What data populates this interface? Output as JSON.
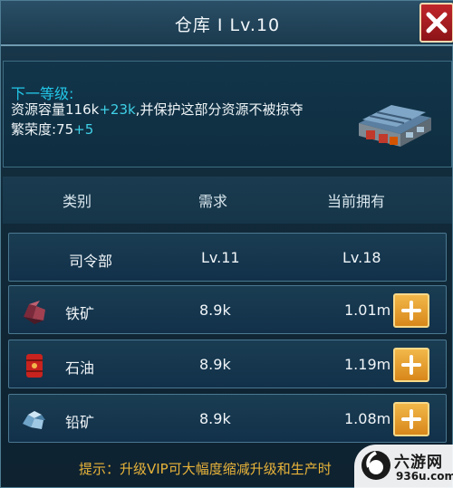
{
  "window": {
    "title": "仓库 I  Lv.10",
    "close_icon": "close-x-icon"
  },
  "next_level": {
    "heading": "下一等级:",
    "capacity_prefix": "资源容量116k",
    "capacity_plus": "+23k",
    "capacity_suffix": ",并保护这部分资源不被掠夺",
    "prosperity_prefix": "繁荣度:75",
    "prosperity_plus": "+5",
    "building_icon": "warehouse-building-icon"
  },
  "table": {
    "headers": {
      "category": "类别",
      "required": "需求",
      "owned": "当前拥有"
    },
    "rows": [
      {
        "name": "司令部",
        "required": "Lv.11",
        "owned": "Lv.18",
        "icon": "",
        "has_add": false
      },
      {
        "name": "铁矿",
        "required": "8.9k",
        "owned": "1.01m",
        "icon": "iron-ore-icon",
        "has_add": true
      },
      {
        "name": "石油",
        "required": "8.9k",
        "owned": "1.19m",
        "icon": "oil-barrel-icon",
        "has_add": true
      },
      {
        "name": "铅矿",
        "required": "8.9k",
        "owned": "1.08m",
        "icon": "lead-ore-icon",
        "has_add": true
      }
    ]
  },
  "tip": "提示：升级VIP可大幅度缩减升级和生产时",
  "watermark": {
    "name": "六游网",
    "url": "936u.com"
  },
  "colors": {
    "accent_cyan": "#22c7e8",
    "tip_gold": "#e8b33a",
    "add_button": "#e8a030",
    "close_red": "#b01e22"
  }
}
